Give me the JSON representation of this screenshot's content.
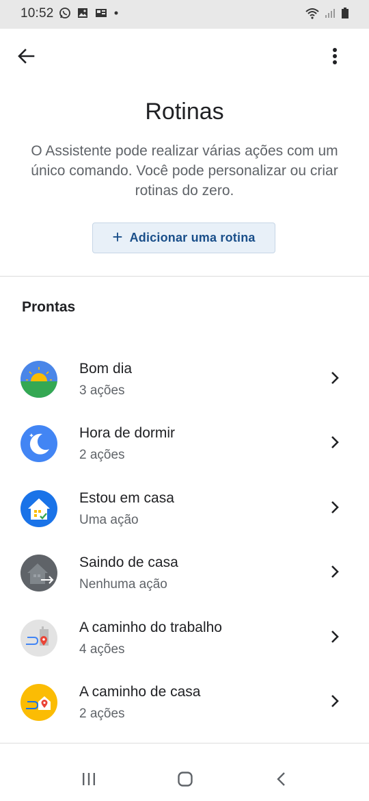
{
  "status_bar": {
    "time": "10:52",
    "left_icons": [
      "whatsapp-icon",
      "gallery-icon",
      "cast-icon",
      "dot-icon"
    ],
    "right_icons": [
      "wifi-icon",
      "signal-icon",
      "battery-icon"
    ]
  },
  "app_bar": {
    "back_icon": "arrow-back-icon",
    "menu_icon": "more-vert-icon"
  },
  "page": {
    "title": "Rotinas",
    "description": "O Assistente pode realizar várias ações com um único comando. Você pode personalizar ou criar rotinas do zero.",
    "add_button_label": "Adicionar uma rotina",
    "add_button_icon": "plus-icon"
  },
  "section": {
    "title": "Prontas"
  },
  "routines": [
    {
      "name": "Bom dia",
      "actions": "3 ações",
      "icon": "sunrise-icon"
    },
    {
      "name": "Hora de dormir",
      "actions": "2 ações",
      "icon": "moon-icon"
    },
    {
      "name": "Estou em casa",
      "actions": "Uma ação",
      "icon": "home-check-icon"
    },
    {
      "name": "Saindo de casa",
      "actions": "Nenhuma ação",
      "icon": "home-leave-icon"
    },
    {
      "name": "A caminho do trabalho",
      "actions": "4 ações",
      "icon": "commute-work-icon"
    },
    {
      "name": "A caminho de casa",
      "actions": "2 ações",
      "icon": "commute-home-icon"
    }
  ],
  "nav_bar": {
    "icons": [
      "recents-icon",
      "home-icon",
      "back-icon"
    ]
  },
  "colors": {
    "accent_blue": "#1a4f8a",
    "button_bg": "#e8f0f8",
    "sky_blue": "#4285f4",
    "grass_green": "#34a853",
    "sun_yellow": "#fbbc04",
    "dark_gray": "#5f6368"
  }
}
